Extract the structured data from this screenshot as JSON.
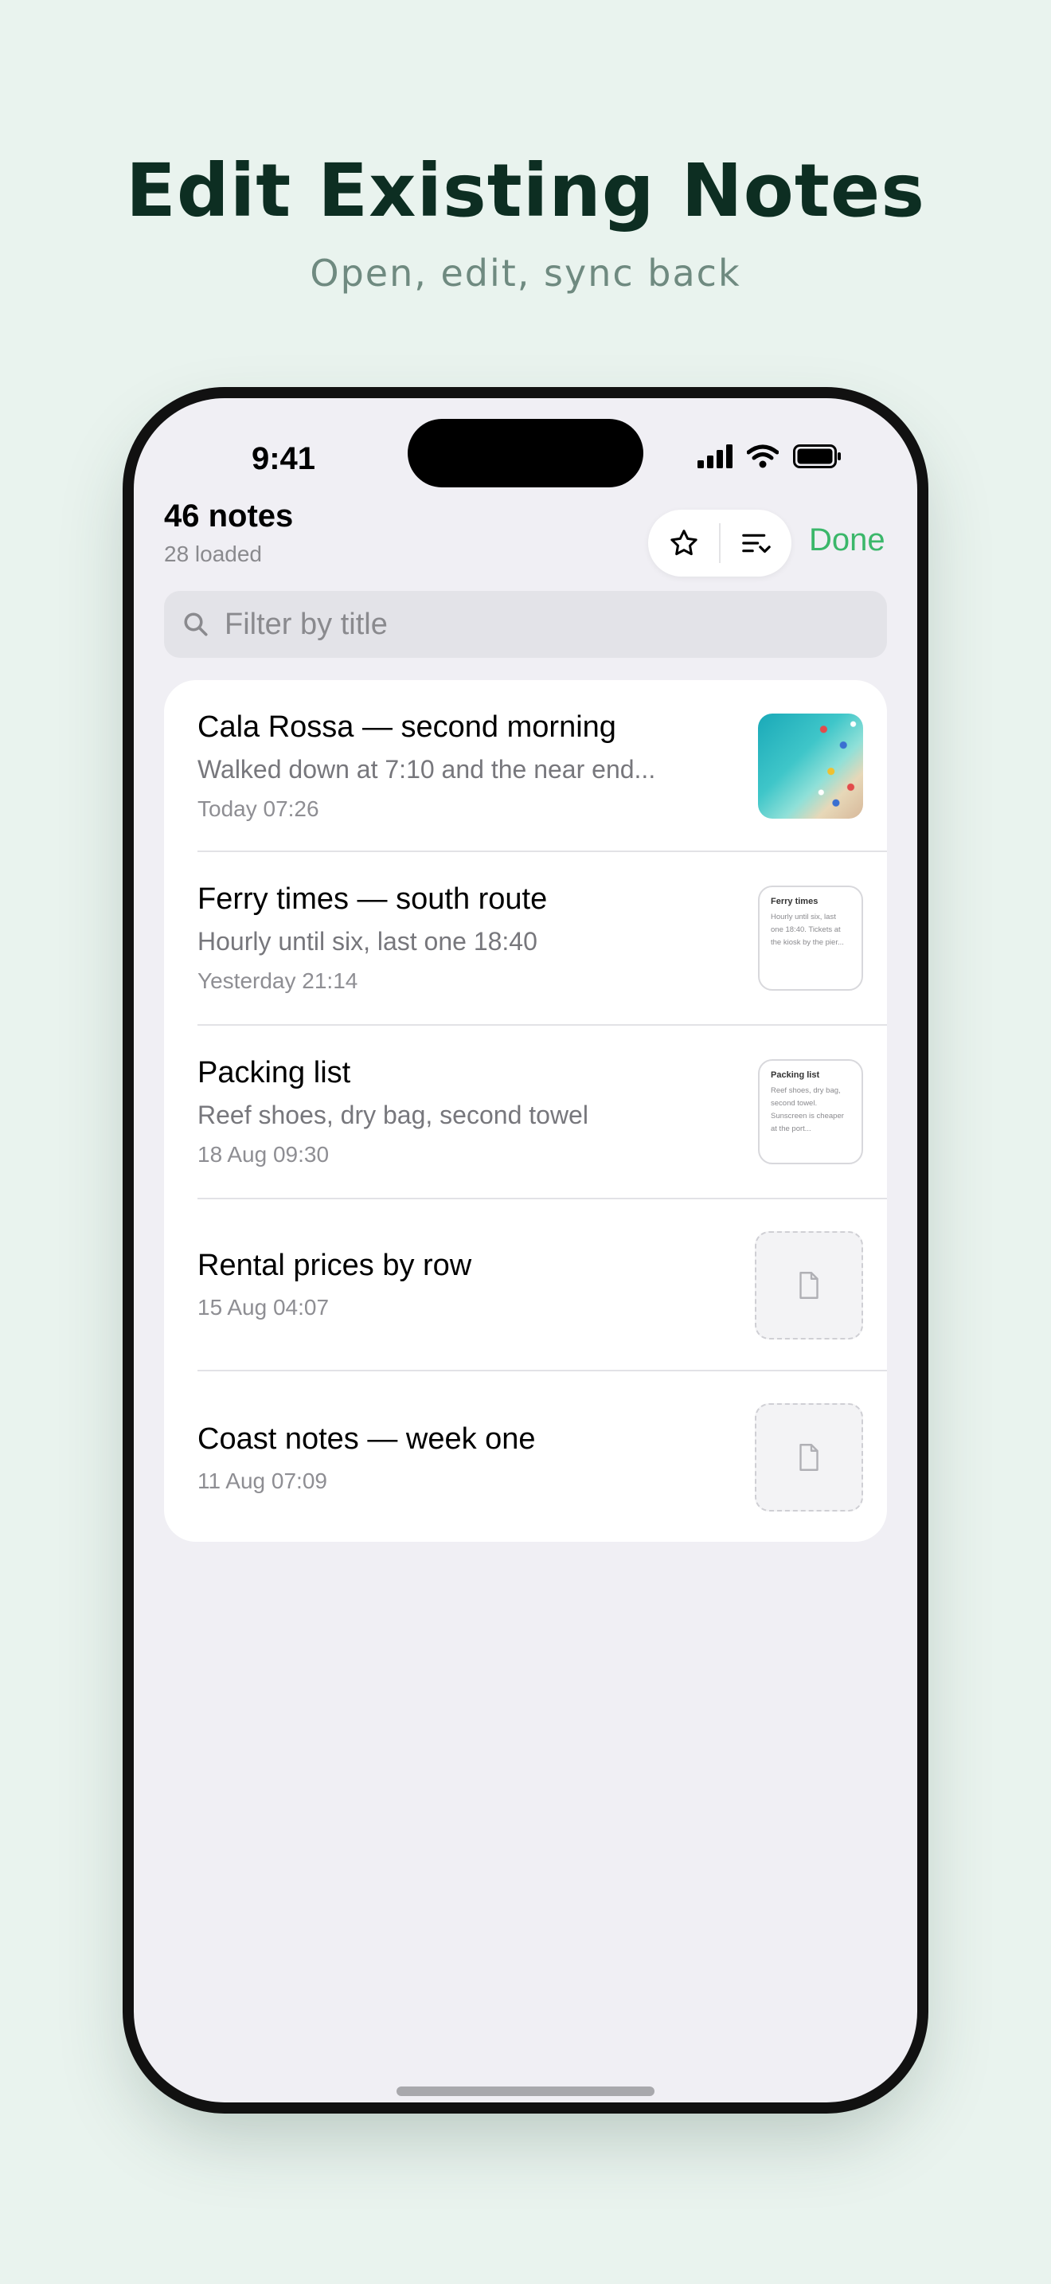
{
  "promo": {
    "headline": "Edit Existing Notes",
    "subheadline": "Open, edit, sync back"
  },
  "status_bar": {
    "time": "9:41",
    "icons": [
      "cellular-signal-icon",
      "wifi-icon",
      "battery-icon"
    ]
  },
  "header": {
    "title": "46 notes",
    "subtitle": "28 loaded",
    "actions": [
      "star-icon",
      "sort-icon"
    ],
    "done_label": "Done"
  },
  "search": {
    "placeholder": "Filter by title",
    "value": ""
  },
  "notes": [
    {
      "title": "Cala Rossa — second morning",
      "preview": "Walked down at 7:10 and the near end...",
      "date": "Today 07:26",
      "thumbnail": "photo"
    },
    {
      "title": "Ferry times — south route",
      "preview": "Hourly until six, last one 18:40",
      "date": "Yesterday 21:14",
      "thumbnail": "note",
      "thumb_title": "Ferry times",
      "thumb_text": "Hourly until six, last one 18:40. Tickets at the kiosk by the pier..."
    },
    {
      "title": "Packing list",
      "preview": "Reef shoes, dry bag, second towel",
      "date": "18 Aug 09:30",
      "thumbnail": "note",
      "thumb_title": "Packing list",
      "thumb_text": "Reef shoes, dry bag, second towel. Sunscreen is cheaper at the port..."
    },
    {
      "title": "Rental prices by row",
      "date": "15 Aug 04:07",
      "thumbnail": "empty"
    },
    {
      "title": "Coast notes — week one",
      "date": "11 Aug 07:09",
      "thumbnail": "empty"
    }
  ],
  "colors": {
    "accent": "#3bb76a",
    "background": "#e9f3ee",
    "headline": "#0d2e22",
    "subheadline": "#6f8a80"
  }
}
